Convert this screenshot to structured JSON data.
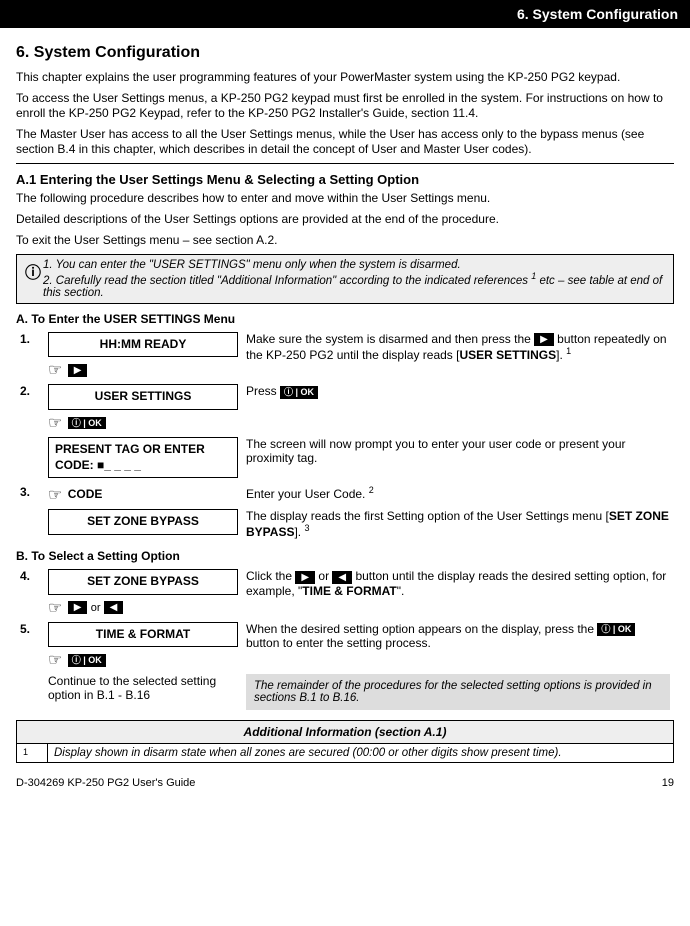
{
  "header": "6. System Configuration",
  "title": "6. System Configuration",
  "intro": {
    "p1": "This chapter explains the user programming features of your PowerMaster system using the KP-250 PG2 keypad.",
    "p2": "To access the User Settings menus, a KP-250 PG2 keypad must first be enrolled in the system. For instructions on how to enroll the KP-250 PG2 Keypad, refer to the KP-250 PG2 Installer's Guide, section 11.4.",
    "p3": "The Master User has access to all the User Settings menus, while the User has access only to the bypass menus (see section B.4 in this chapter, which describes in detail the concept of User and Master User codes)."
  },
  "a1": {
    "heading": "A.1 Entering the User Settings Menu & Selecting a Setting Option",
    "p1": "The following procedure describes how to enter and move within the User Settings menu.",
    "p2": "Detailed descriptions of the User Settings options are provided at the end of the procedure.",
    "p3": "To exit the User Settings menu – see section A.2."
  },
  "note": {
    "n1": "1. You can enter the \"USER SETTINGS\" menu only when the system is disarmed.",
    "n2a": "2. Carefully read the section titled \"Additional Information\" according to the indicated references ",
    "n2sup": "1",
    "n2b": " etc – see table at end of this section."
  },
  "secA": {
    "label": "A. To Enter the USER SETTINGS Menu",
    "s1": {
      "num": "1.",
      "display": "HH:MM     READY",
      "text_a": "Make sure the system is disarmed and then press the ",
      "text_b": " button repeatedly on the KP-250 PG2 until the display reads [",
      "bold": "USER SETTINGS",
      "text_c": "]. ",
      "sup": "1"
    },
    "s2": {
      "num": "2.",
      "display": "USER SETTINGS",
      "text_a": "Press "
    },
    "s2b": {
      "display": "PRESENT TAG OR ENTER CODE: ■_ _ _ _",
      "text": "The screen will now prompt you to enter your user code or present your proximity tag."
    },
    "s3": {
      "num": "3.",
      "codeLabel": "CODE",
      "text_a": "Enter your User Code. ",
      "sup": "2",
      "display": "SET ZONE BYPASS",
      "text_b": "The display reads the first Setting option of the User Settings menu [",
      "bold": "SET ZONE BYPASS",
      "text_c": "]. ",
      "sup2": "3"
    }
  },
  "secB": {
    "label": "B. To Select a Setting Option",
    "s4": {
      "num": "4.",
      "display": "SET ZONE BYPASS",
      "text_a": "Click the ",
      "or": " or ",
      "text_b": " button until the display reads the desired setting option, for example, \"",
      "bold": "TIME & FORMAT",
      "text_c": "\".",
      "orText": " or "
    },
    "s5": {
      "num": "5.",
      "display": "TIME & FORMAT",
      "text_a": "When the desired setting option appears on the display, press the ",
      "text_b": " button to enter the setting process."
    },
    "cont": {
      "left": "Continue to the selected setting option in B.1 - B.16",
      "right": "The remainder of the procedures for the selected setting options is provided in sections B.1 to B.16."
    }
  },
  "addl": {
    "header": "Additional Information (section A.1)",
    "fn1": "1",
    "row1": "Display shown in disarm state when all zones are secured (00:00 or other digits show present time)."
  },
  "footer": {
    "left": "D-304269 KP-250 PG2 User's Guide",
    "right": "19"
  },
  "btn": {
    "fwd": "▶",
    "back": "◀",
    "ok": "ⓘ | OK"
  }
}
